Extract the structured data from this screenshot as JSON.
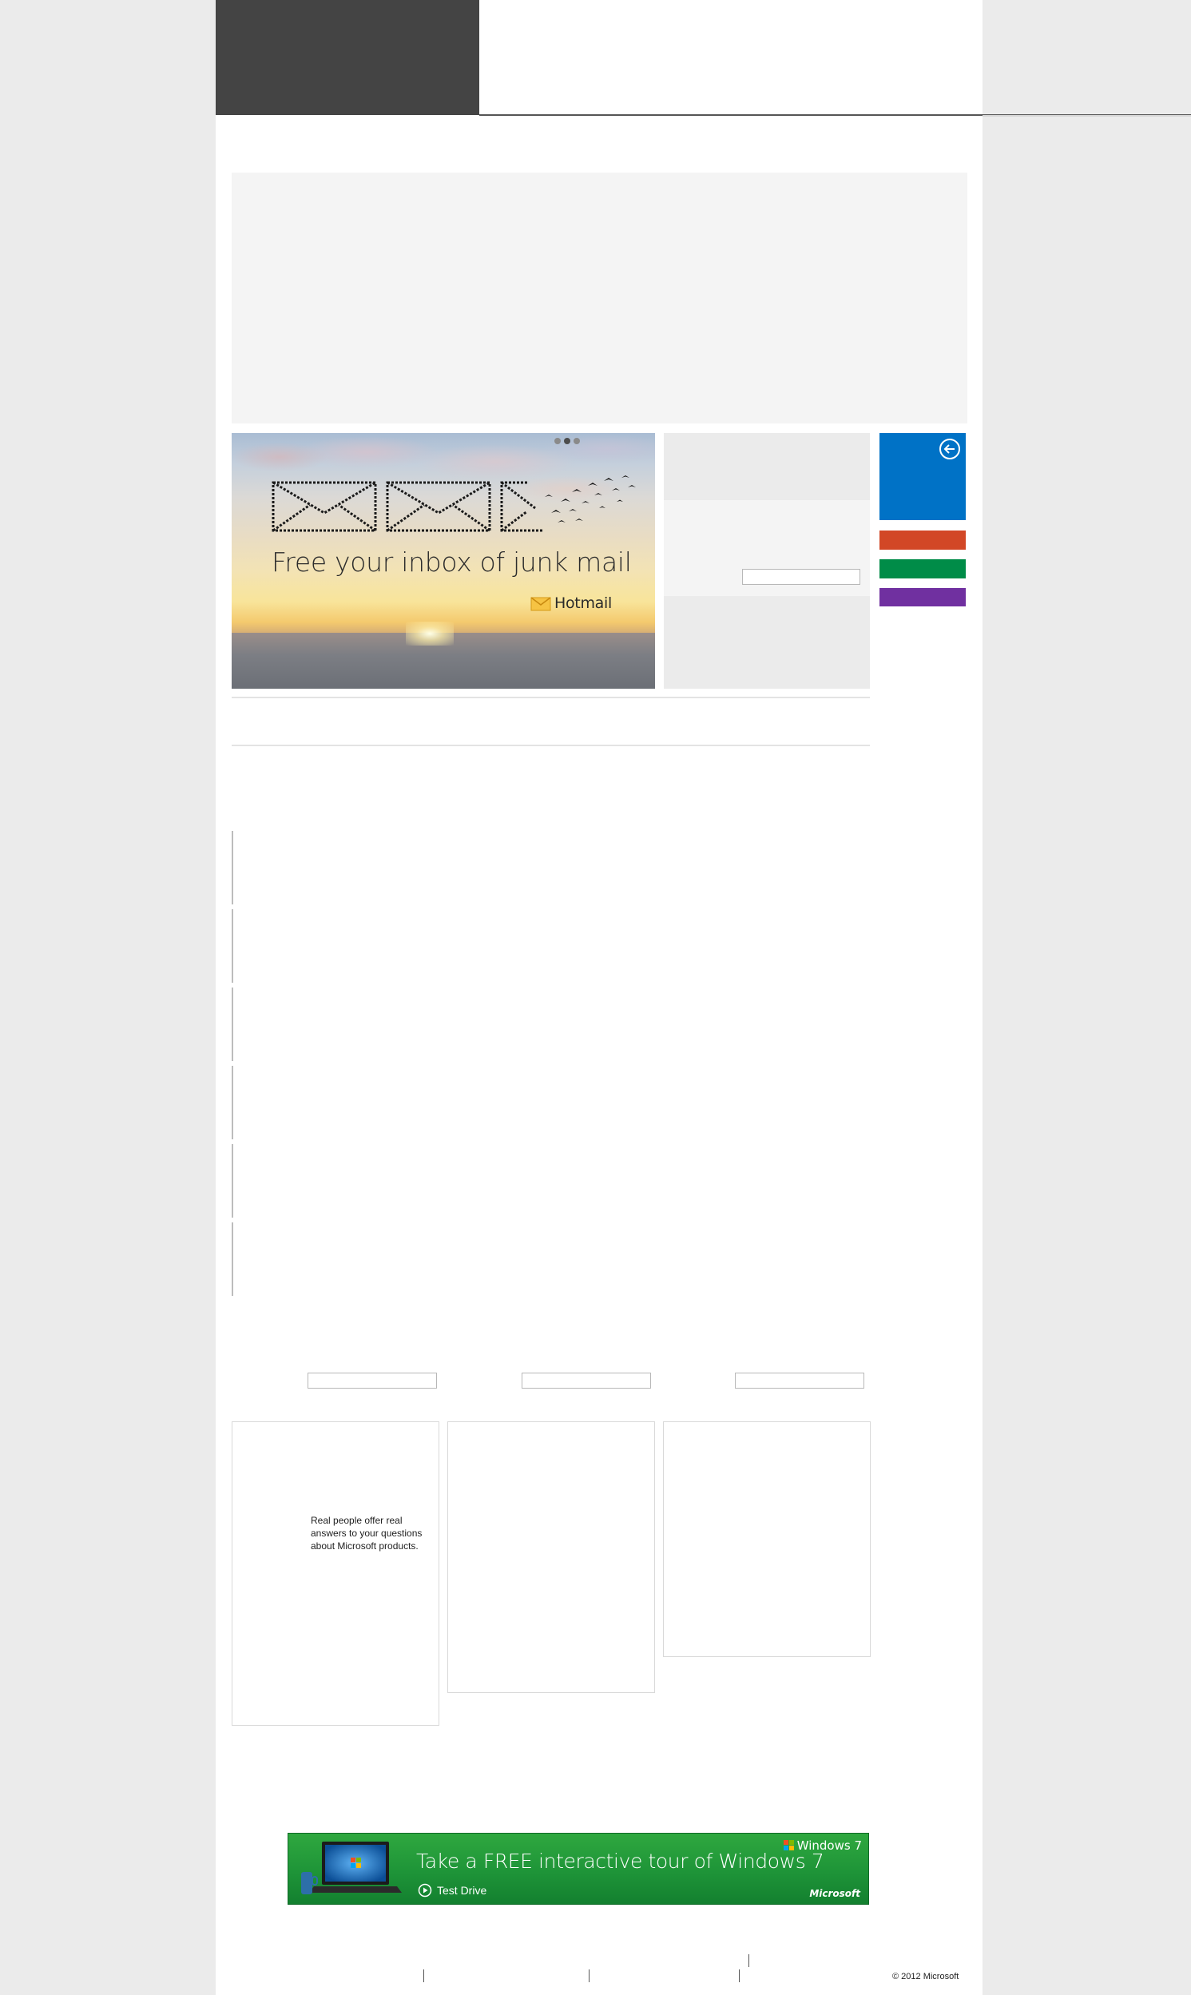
{
  "hero": {
    "headline": "Free your inbox of junk mail",
    "brand": "Hotmail",
    "slide_count": 3,
    "active_slide": 2
  },
  "side_panel": {
    "search_value": ""
  },
  "tiles": {
    "blue": "#0072c6",
    "orange": "#d24726",
    "green": "#008c48",
    "purple": "#7030a0",
    "back_icon": "arrow-left-circle-icon"
  },
  "search_fields": [
    {
      "value": ""
    },
    {
      "value": ""
    },
    {
      "value": ""
    }
  ],
  "cards": {
    "community_text": "Real people offer real answers to your questions about Microsoft products."
  },
  "ad": {
    "headline": "Take a FREE interactive tour of Windows 7",
    "cta": "Test Drive",
    "product": "Windows 7",
    "company": "Microsoft",
    "accent": "#1e9438"
  },
  "footer": {
    "copyright": "© 2012 Microsoft"
  }
}
